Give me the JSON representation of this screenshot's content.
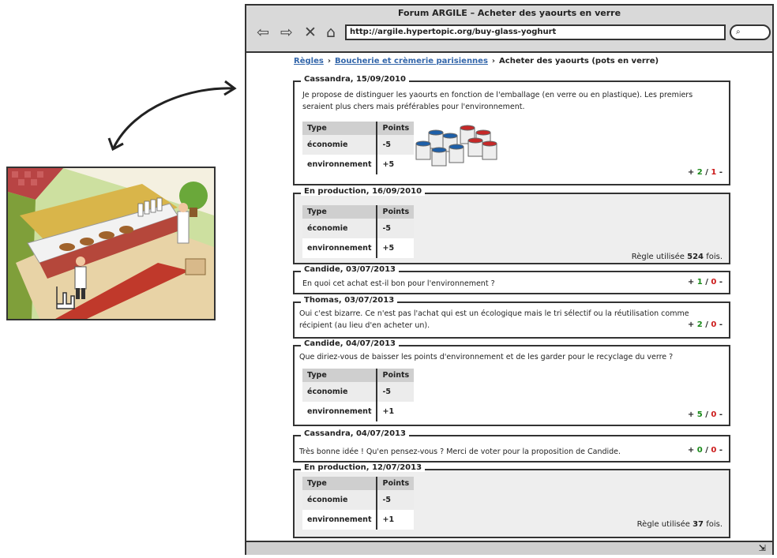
{
  "browser": {
    "window_title": "Forum ARGILE – Acheter des yaourts en verre",
    "url": "http://argile.hypertopic.org/buy-glass-yoghurt",
    "nav_icons": [
      "back-arrow-icon",
      "forward-arrow-icon",
      "stop-icon",
      "home-icon"
    ]
  },
  "breadcrumb": {
    "items": [
      "Règles",
      "Boucherie et crèmerie parisiennes"
    ],
    "current": "Acheter des yaourts (pots en verre)"
  },
  "colors": {
    "vote_up": "#1a8a1a",
    "vote_down": "#cc1a1a",
    "link": "#3366aa",
    "production_bg": "#eeeeee"
  },
  "posts": [
    {
      "header": "Cassandra, 15/09/2010",
      "text": "Je propose de distinguer les yaourts en fonction de l'emballage (en verre ou en plastique). Les premiers seraient plus chers mais préférables pour l'environnement.",
      "table": {
        "headers": [
          "Type",
          "Points"
        ],
        "rows": [
          [
            "économie",
            "-5"
          ],
          [
            "environnement",
            "+5"
          ]
        ]
      },
      "image": "glass-yoghurt-jars",
      "vote": {
        "up": "2",
        "down": "1"
      }
    },
    {
      "header": "En production, 16/09/2010",
      "table": {
        "headers": [
          "Type",
          "Points"
        ],
        "rows": [
          [
            "économie",
            "-5"
          ],
          [
            "environnement",
            "+5"
          ]
        ]
      },
      "usage": {
        "prefix": "Règle utilisée",
        "count": "524",
        "suffix": "fois."
      }
    },
    {
      "header": "Candide, 03/07/2013",
      "text": "En quoi cet achat est-il bon pour l'environnement ?",
      "vote": {
        "up": "1",
        "down": "0"
      }
    },
    {
      "header": "Thomas, 03/07/2013",
      "text": "Oui c'est bizarre. Ce n'est pas l'achat qui est un écologique mais le tri sélectif ou la réutilisation comme récipient (au lieu d'en acheter un).",
      "vote": {
        "up": "2",
        "down": "0"
      }
    },
    {
      "header": "Candide, 04/07/2013",
      "text": "Que diriez-vous de baisser les points d'environnement et de les garder pour le recyclage du verre ?",
      "table": {
        "headers": [
          "Type",
          "Points"
        ],
        "rows": [
          [
            "économie",
            "-5"
          ],
          [
            "environnement",
            "+1"
          ]
        ]
      },
      "vote": {
        "up": "5",
        "down": "0"
      }
    },
    {
      "header": "Cassandra, 04/07/2013",
      "text": "Très bonne idée ! Qu'en pensez-vous ? Merci de voter pour la proposition de Candide.",
      "vote": {
        "up": "0",
        "down": "0"
      }
    },
    {
      "header": "En production, 12/07/2013",
      "table": {
        "headers": [
          "Type",
          "Points"
        ],
        "rows": [
          [
            "économie",
            "-5"
          ],
          [
            "environnement",
            "+1"
          ]
        ]
      },
      "usage": {
        "prefix": "Règle utilisée",
        "count": "37",
        "suffix": "fois."
      }
    }
  ]
}
